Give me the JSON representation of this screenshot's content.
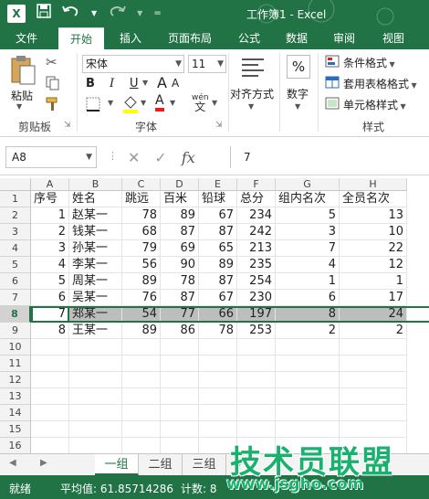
{
  "title": "工作簿1 - Excel",
  "qat": {
    "excel_icon": "X",
    "save_icon": "save-icon",
    "undo_icon": "undo-icon",
    "redo_icon": "redo-icon"
  },
  "tabs": [
    "文件",
    "开始",
    "插入",
    "页面布局",
    "公式",
    "数据",
    "审阅",
    "视图"
  ],
  "ribbon": {
    "paste_label": "粘贴",
    "clipboard_label": "剪贴板",
    "font_name": "宋体",
    "font_size": "11",
    "font_group_label": "字体",
    "bold": "B",
    "italic": "I",
    "underline": "U",
    "grow_font": "A",
    "shrink_font": "A",
    "phonetic": "wén",
    "alignment_label": "对齐方式",
    "number_label": "数字",
    "percent_symbol": "%",
    "conditional_format": "条件格式",
    "table_format": "套用表格格式",
    "cell_style": "单元格样式",
    "styles_label": "样式"
  },
  "formula_bar": {
    "name_box": "A8",
    "cancel": "✕",
    "enter": "✓",
    "fx": "fx",
    "content": "7"
  },
  "columns": [
    "A",
    "B",
    "C",
    "D",
    "E",
    "F",
    "G",
    "H"
  ],
  "rows": [
    [
      "序号",
      "姓名",
      "跳远",
      "百米",
      "铅球",
      "总分",
      "组内名次",
      "全员名次"
    ],
    [
      "1",
      "赵某一",
      "78",
      "89",
      "67",
      "234",
      "5",
      "13"
    ],
    [
      "2",
      "钱某一",
      "68",
      "87",
      "87",
      "242",
      "3",
      "10"
    ],
    [
      "3",
      "孙某一",
      "79",
      "69",
      "65",
      "213",
      "7",
      "22"
    ],
    [
      "4",
      "李某一",
      "56",
      "90",
      "89",
      "235",
      "4",
      "12"
    ],
    [
      "5",
      "周某一",
      "89",
      "78",
      "87",
      "254",
      "1",
      "1"
    ],
    [
      "6",
      "吴某一",
      "76",
      "87",
      "67",
      "230",
      "6",
      "17"
    ],
    [
      "7",
      "郑某一",
      "54",
      "77",
      "66",
      "197",
      "8",
      "24"
    ],
    [
      "8",
      "王某一",
      "89",
      "86",
      "78",
      "253",
      "2",
      "2"
    ]
  ],
  "row_numbers": [
    "1",
    "2",
    "3",
    "4",
    "5",
    "6",
    "7",
    "8",
    "9",
    "10",
    "11",
    "12",
    "13",
    "14",
    "15",
    "16"
  ],
  "sheets": [
    "一组",
    "二组",
    "三组"
  ],
  "status": {
    "ready": "就绪",
    "average": "平均值: 61.85714286",
    "count": "计数: 8"
  },
  "watermark": {
    "text": "技术员联盟",
    "url": "www.jsgho.com"
  },
  "colors": {
    "accent": "#217346",
    "selected_row": "#bdbdbd",
    "watermark": "#18b26e"
  }
}
